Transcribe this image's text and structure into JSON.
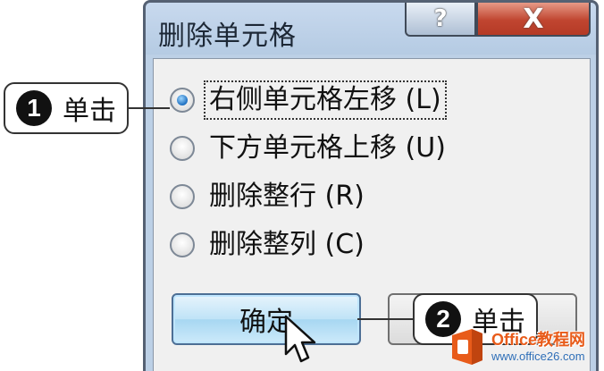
{
  "dialog": {
    "title": "删除单元格",
    "help_label": "?",
    "close_label": "X"
  },
  "options": [
    {
      "label": "右侧单元格左移 (L)",
      "checked": true
    },
    {
      "label": "下方单元格上移 (U)",
      "checked": false
    },
    {
      "label": "删除整行 (R)",
      "checked": false
    },
    {
      "label": "删除整列 (C)",
      "checked": false
    }
  ],
  "buttons": {
    "ok_label": "确定"
  },
  "callouts": [
    {
      "number": "1",
      "text": "单击"
    },
    {
      "number": "2",
      "text": "单击"
    }
  ],
  "watermark": {
    "brand": "Office教程网",
    "url": "www.office26.com"
  },
  "colors": {
    "accent": "#1e6fc0",
    "close": "#c04530",
    "watermark": "#e85b1a"
  }
}
